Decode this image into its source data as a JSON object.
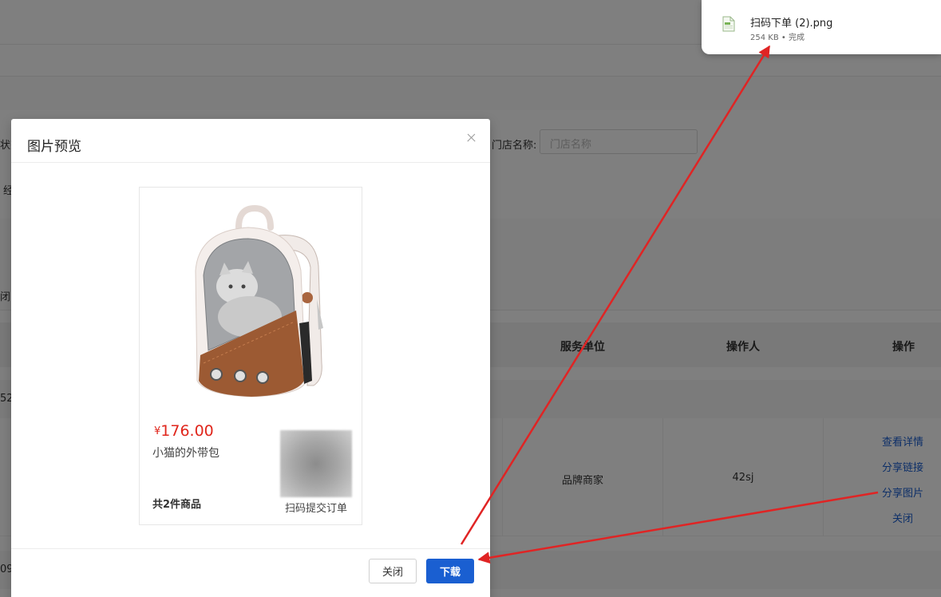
{
  "background": {
    "filter_store_label": "门店名称:",
    "filter_store_placeholder": "门店名称",
    "fragments": {
      "status_partial": "状态",
      "row2_partial": "经",
      "close_partial": "闭",
      "group1_partial": "52",
      "group2_partial": "09"
    },
    "table_headers": [
      "服务单位",
      "操作人",
      "操作"
    ],
    "row": {
      "service_unit": "品牌商家",
      "operator": "42sj",
      "actions": [
        "查看详情",
        "分享链接",
        "分享图片",
        "关闭"
      ]
    }
  },
  "modal": {
    "title": "图片预览",
    "poster": {
      "price_symbol": "¥",
      "price": "176.00",
      "product_name": "小猫的外带包",
      "item_count": "共2件商品",
      "qr_caption": "扫码提交订单"
    },
    "buttons": {
      "close": "关闭",
      "download": "下载"
    }
  },
  "download": {
    "file_name": "扫码下单 (2).png",
    "status": "254 KB • 完成"
  },
  "colors": {
    "primary": "#1a5fd1",
    "price": "#e0261c",
    "annotation": "#e02424"
  }
}
